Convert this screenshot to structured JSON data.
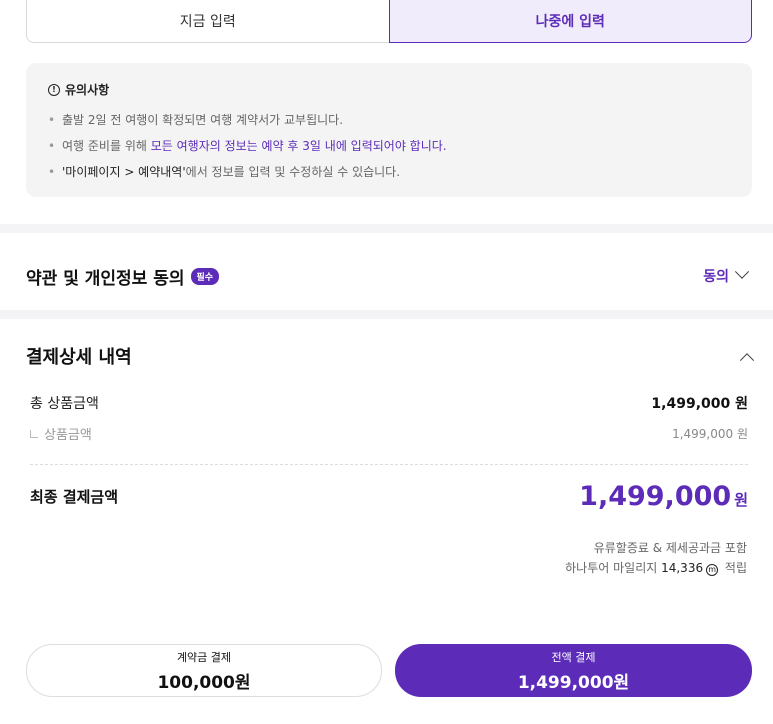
{
  "input_toggle": {
    "now_label": "지금 입력",
    "later_label": "나중에 입력"
  },
  "notice": {
    "title": "유의사항",
    "items": [
      {
        "text": "출발 2일 전 여행이 확정되면 여행 계약서가 교부됩니다."
      },
      {
        "pre": "여행 준비를 위해 ",
        "highlight": "모든 여행자의 정보는 예약 후 3일 내에 입력되어야 합니다."
      },
      {
        "strong": "'마이페이지 > 예약내역'",
        "post": "에서 정보를 입력 및 수정하실 수 있습니다."
      }
    ]
  },
  "agreement": {
    "title": "약관 및 개인정보 동의",
    "badge": "필수",
    "action": "동의"
  },
  "payment": {
    "title": "결제상세 내역",
    "total_label": "총 상품금액",
    "total_amount": "1,499,000",
    "total_unit": "원",
    "sub_label": "상품금액",
    "sub_amount": "1,499,000 원",
    "final_label": "최종 결제금액",
    "final_amount": "1,499,000",
    "final_unit": "원",
    "note_fuel": "유류할증료 & 제세공과금 포함",
    "mileage_prefix": "하나투어 마일리지 ",
    "mileage_amount": "14,336",
    "mileage_icon": "Ⓜ",
    "mileage_suffix": " 적립"
  },
  "buttons": {
    "deposit_label": "계약금 결제",
    "deposit_amount": "100,000원",
    "full_label": "전액 결제",
    "full_amount": "1,499,000원"
  },
  "colors": {
    "accent": "#5c2cb9",
    "accent_light": "#f1ecfb",
    "notice_bg": "#f4f4f5"
  }
}
